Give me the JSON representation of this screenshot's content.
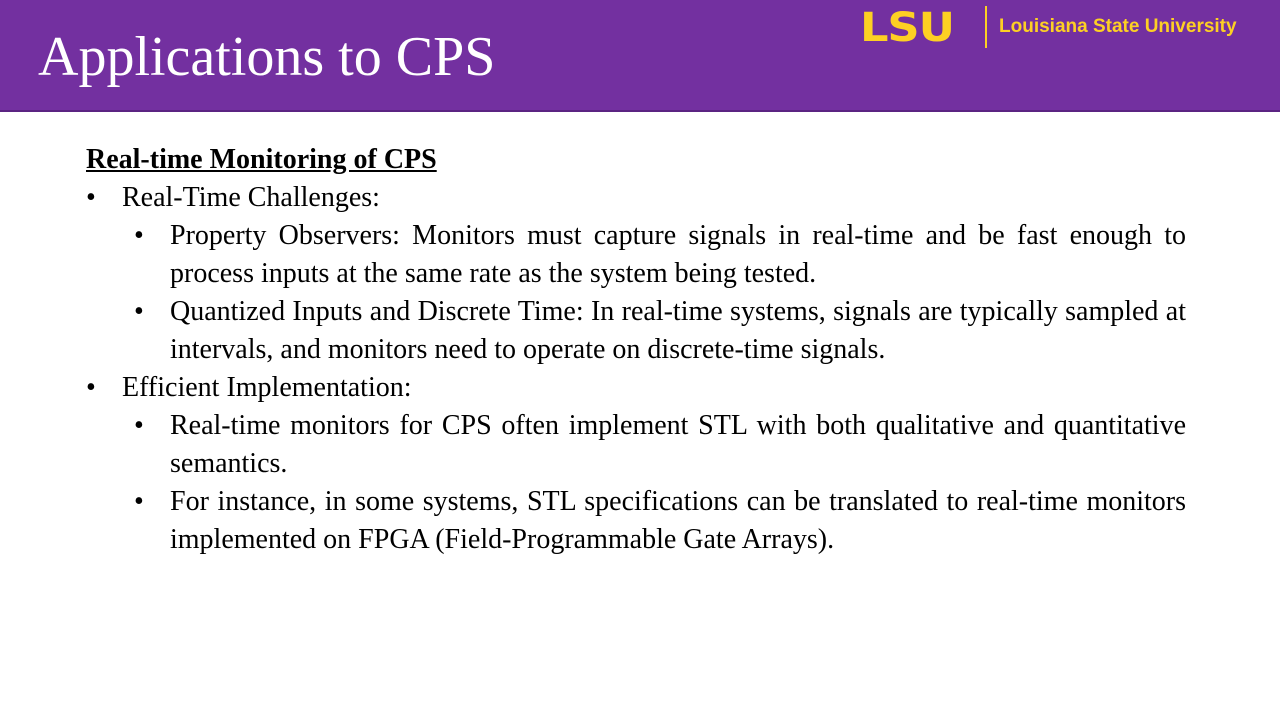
{
  "header": {
    "title": "Applications to CPS",
    "logo": {
      "mark": "LSU",
      "name": "Louisiana State University"
    }
  },
  "colors": {
    "header_bg": "#7330a0",
    "logo_gold": "#fdd023"
  },
  "content": {
    "heading": "Real-time Monitoring of CPS",
    "bullet_symbol": "•",
    "sections": [
      {
        "label": "Real-Time Challenges:",
        "items": [
          "Property Observers: Monitors must capture signals in real-time and be fast enough to process inputs at the same rate as the system being tested.",
          "Quantized Inputs and Discrete Time: In real-time systems, signals are typically sampled at intervals, and monitors need to operate on discrete-time signals."
        ]
      },
      {
        "label": "Efficient Implementation:",
        "items": [
          "Real-time monitors for CPS often implement STL with both qualitative and quantitative semantics.",
          "For instance, in some systems, STL specifications can be translated to real-time monitors implemented on FPGA (Field-Programmable Gate Arrays)."
        ]
      }
    ]
  }
}
